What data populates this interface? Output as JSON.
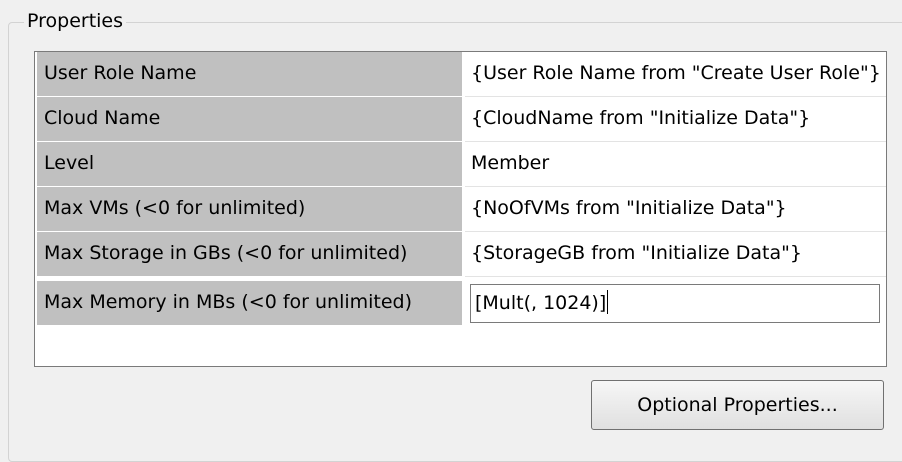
{
  "group": {
    "title": "Properties"
  },
  "properties": [
    {
      "name": "User Role Name",
      "value": "{User Role Name from \"Create User Role\"}"
    },
    {
      "name": "Cloud Name",
      "value": "{CloudName from \"Initialize Data\"}"
    },
    {
      "name": "Level",
      "value": "Member"
    },
    {
      "name": "Max VMs (<0 for unlimited)",
      "value": "{NoOfVMs from \"Initialize Data\"}"
    },
    {
      "name": "Max Storage in GBs (<0 for unlimited)",
      "value": "{StorageGB from \"Initialize Data\"}"
    },
    {
      "name": "Max Memory in MBs (<0 for unlimited)",
      "value": "[Mult(, 1024)]"
    }
  ],
  "buttons": {
    "optional_properties": "Optional Properties..."
  }
}
